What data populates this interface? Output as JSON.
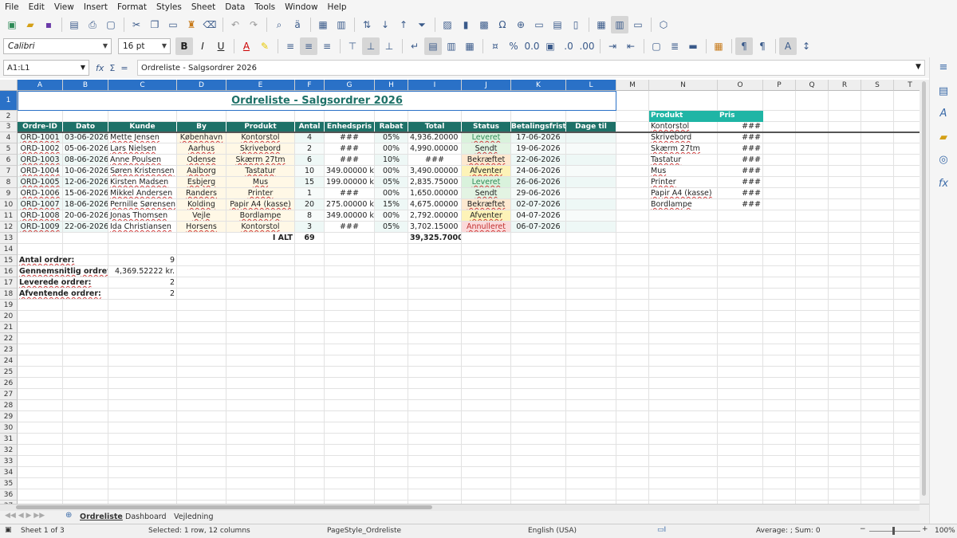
{
  "menu": [
    "File",
    "Edit",
    "View",
    "Insert",
    "Format",
    "Styles",
    "Sheet",
    "Data",
    "Tools",
    "Window",
    "Help"
  ],
  "toolbar": {
    "font_name": "Calibri",
    "font_size": "16 pt"
  },
  "formula_bar": {
    "name_box": "A1:L1",
    "formula": "Ordreliste - Salgsordrer 2026",
    "fx": "fx",
    "sum": "Σ",
    "eq": "="
  },
  "columns": [
    "A",
    "B",
    "C",
    "D",
    "E",
    "F",
    "G",
    "H",
    "I",
    "J",
    "K",
    "L",
    "M",
    "N",
    "O",
    "P",
    "Q",
    "R",
    "S",
    "T"
  ],
  "rows": [
    "1",
    "2",
    "3",
    "4",
    "5",
    "6",
    "7",
    "8",
    "9",
    "10",
    "11",
    "12",
    "13",
    "14",
    "15",
    "16",
    "17",
    "18",
    "19",
    "20",
    "21",
    "22",
    "23",
    "24",
    "25",
    "26",
    "27",
    "28",
    "29",
    "30",
    "31",
    "32",
    "33",
    "34",
    "35",
    "36",
    "37"
  ],
  "sheet": {
    "title": "Ordreliste - Salgsordrer 2026",
    "headers": [
      "Ordre-ID",
      "Dato",
      "Kunde",
      "By",
      "Produkt",
      "Antal",
      "Enhedspris",
      "Rabat",
      "Total",
      "Status",
      "Betalingsfrist",
      "Dage til frist"
    ],
    "orders": [
      [
        "ORD-1001",
        "03-06-2026",
        "Mette Jensen",
        "København",
        "Kontorstol",
        "4",
        "###",
        "05%",
        "4,936.20000 kr.",
        "Leveret",
        "17-06-2026"
      ],
      [
        "ORD-1002",
        "05-06-2026",
        "Lars Nielsen",
        "Aarhus",
        "Skrivebord",
        "2",
        "###",
        "00%",
        "4,990.00000 kr.",
        "Sendt",
        "19-06-2026"
      ],
      [
        "ORD-1003",
        "08-06-2026",
        "Anne Poulsen",
        "Odense",
        "Skærm 27tm",
        "6",
        "###",
        "10%",
        "###",
        "Bekræftet",
        "22-06-2026"
      ],
      [
        "ORD-1004",
        "10-06-2026",
        "Søren Kristensen",
        "Aalborg",
        "Tastatur",
        "10",
        "349.00000 kr.",
        "00%",
        "3,490.00000 kr.",
        "Afventer",
        "24-06-2026"
      ],
      [
        "ORD-1005",
        "12-06-2026",
        "Kirsten Madsen",
        "Esbjerg",
        "Mus",
        "15",
        "199.00000 kr.",
        "05%",
        "2,835.75000 kr.",
        "Leveret",
        "26-06-2026"
      ],
      [
        "ORD-1006",
        "15-06-2026",
        "Mikkel Andersen",
        "Randers",
        "Printer",
        "1",
        "###",
        "00%",
        "1,650.00000 kr.",
        "Sendt",
        "29-06-2026"
      ],
      [
        "ORD-1007",
        "18-06-2026",
        "Pernille Sørensen",
        "Kolding",
        "Papir A4 (kasse)",
        "20",
        "275.00000 kr.",
        "15%",
        "4,675.00000 kr.",
        "Bekræftet",
        "02-07-2026"
      ],
      [
        "ORD-1008",
        "20-06-2026",
        "Jonas Thomsen",
        "Vejle",
        "Bordlampe",
        "8",
        "349.00000 kr.",
        "00%",
        "2,792.00000 kr.",
        "Afventer",
        "04-07-2026"
      ],
      [
        "ORD-1009",
        "22-06-2026",
        "Ida Christiansen",
        "Horsens",
        "Kontorstol",
        "3",
        "###",
        "05%",
        "3,702.15000 kr.",
        "Annulleret",
        "06-07-2026"
      ]
    ],
    "total_label": "I ALT",
    "total_qty": "69",
    "total_amount": "39,325.70000 kr.",
    "stats": [
      {
        "label": "Antal ordrer:",
        "value": "9"
      },
      {
        "label": "Gennemsnitlig ordreværdi:",
        "value": "4,369.52222 kr."
      },
      {
        "label": "Leverede ordrer:",
        "value": "2"
      },
      {
        "label": "Afventende ordrer:",
        "value": "2"
      }
    ],
    "lookup_headers": [
      "Produkt",
      "Pris"
    ],
    "lookup": [
      [
        "Kontorstol",
        "###"
      ],
      [
        "Skrivebord",
        "###"
      ],
      [
        "Skærm 27tm",
        "###"
      ],
      [
        "Tastatur",
        "###"
      ],
      [
        "Mus",
        "###"
      ],
      [
        "Printer",
        "###"
      ],
      [
        "Papir A4 (kasse)",
        "###"
      ],
      [
        "Bordlampe",
        "###"
      ]
    ]
  },
  "status_colors": {
    "Leveret": "#d9f2dc",
    "Sendt": "#e3f4e3",
    "Bekræftet": "#fde9d0",
    "Afventer": "#fdf3b8",
    "Annulleret": "#fbdada"
  },
  "tabs": [
    "Ordreliste",
    "Dashboard",
    "Vejledning"
  ],
  "statusbar": {
    "sheet": "Sheet 1 of 3",
    "selection": "Selected: 1 row, 12 columns",
    "pagestyle": "PageStyle_Ordreliste",
    "language": "English (USA)",
    "summary": "Average: ; Sum: 0",
    "zoom": "100%"
  }
}
